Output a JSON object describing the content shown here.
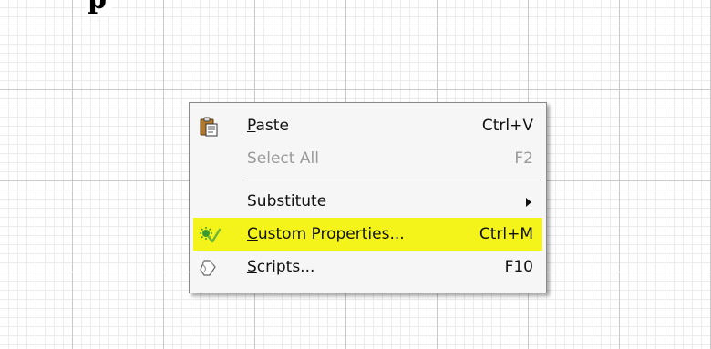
{
  "page": {
    "heading_fragment": "p"
  },
  "context_menu": {
    "items": [
      {
        "id": "paste",
        "label_mnemonic": "P",
        "label_rest": "aste",
        "shortcut": "Ctrl+V",
        "icon": "clipboard-paste-icon",
        "enabled": true,
        "highlighted": false
      },
      {
        "id": "select-all",
        "label": "Select All",
        "shortcut": "F2",
        "enabled": false,
        "highlighted": false
      },
      {
        "id": "substitute",
        "label": "Substitute",
        "has_submenu": true,
        "enabled": true,
        "highlighted": false
      },
      {
        "id": "custom-properties",
        "label_mnemonic": "C",
        "label_rest": "ustom Properties...",
        "shortcut": "Ctrl+M",
        "icon": "custom-properties-icon",
        "enabled": true,
        "highlighted": true
      },
      {
        "id": "scripts",
        "label_mnemonic": "S",
        "label_rest": "cripts...",
        "shortcut": "F10",
        "icon": "script-scroll-icon",
        "enabled": true,
        "highlighted": false
      }
    ]
  },
  "colors": {
    "highlight": "#f4f41a",
    "menu_background": "#f6f6f6",
    "disabled_text": "#9a9a9a",
    "grid_major": "#c9c9c9",
    "grid_minor": "#ececec"
  }
}
